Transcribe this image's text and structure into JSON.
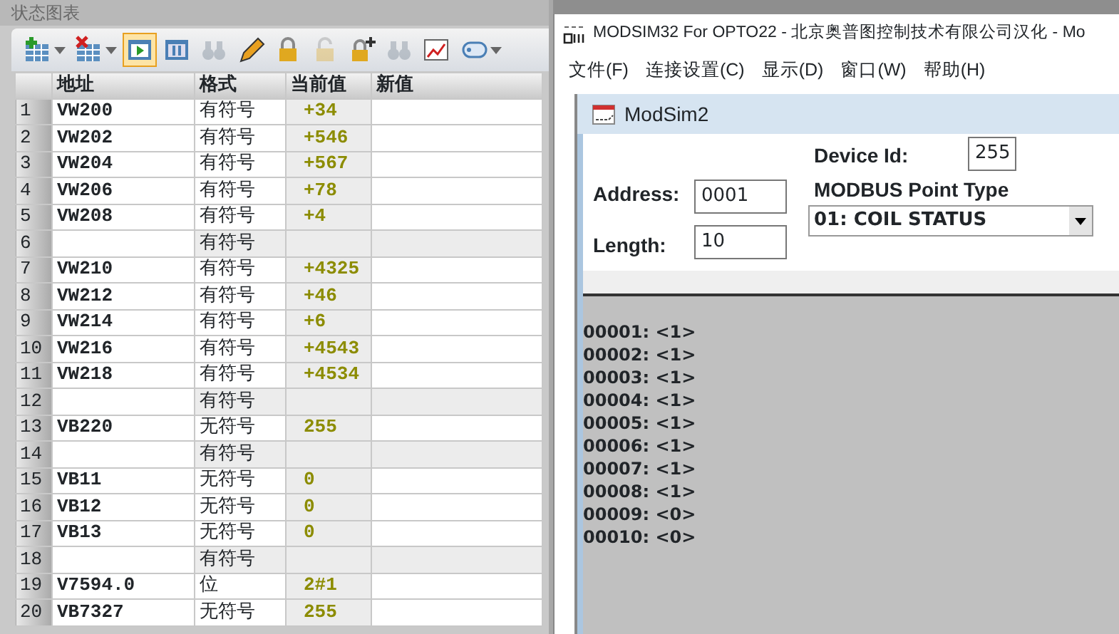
{
  "status_chart": {
    "title": "状态图表",
    "toolbar": [
      {
        "kind": "add-row",
        "caret": true,
        "selected": false,
        "disabled": false
      },
      {
        "kind": "delete-row",
        "caret": true,
        "selected": false,
        "disabled": false
      },
      {
        "kind": "play",
        "caret": false,
        "selected": true,
        "disabled": false
      },
      {
        "kind": "pause",
        "caret": false,
        "selected": false,
        "disabled": false
      },
      {
        "kind": "binoculars",
        "caret": false,
        "selected": false,
        "disabled": true
      },
      {
        "kind": "pencil",
        "caret": false,
        "selected": false,
        "disabled": false
      },
      {
        "kind": "lock",
        "caret": false,
        "selected": false,
        "disabled": false
      },
      {
        "kind": "unlock",
        "caret": false,
        "selected": false,
        "disabled": true
      },
      {
        "kind": "lock-plus",
        "caret": false,
        "selected": false,
        "disabled": false
      },
      {
        "kind": "binoculars",
        "caret": false,
        "selected": false,
        "disabled": true
      },
      {
        "kind": "chart",
        "caret": false,
        "selected": false,
        "disabled": false
      },
      {
        "kind": "tag",
        "caret": true,
        "selected": false,
        "disabled": false
      }
    ],
    "columns": [
      "地址",
      "格式",
      "当前值",
      "新值"
    ],
    "rows": [
      {
        "index": "1",
        "address": "VW200",
        "format": "有符号",
        "value": "+34"
      },
      {
        "index": "2",
        "address": "VW202",
        "format": "有符号",
        "value": "+546"
      },
      {
        "index": "3",
        "address": "VW204",
        "format": "有符号",
        "value": "+567"
      },
      {
        "index": "4",
        "address": "VW206",
        "format": "有符号",
        "value": "+78"
      },
      {
        "index": "5",
        "address": "VW208",
        "format": "有符号",
        "value": "+4"
      },
      {
        "index": "6",
        "format": "有符号"
      },
      {
        "index": "7",
        "address": "VW210",
        "format": "有符号",
        "value": "+4325"
      },
      {
        "index": "8",
        "address": "VW212",
        "format": "有符号",
        "value": "+46"
      },
      {
        "index": "9",
        "address": "VW214",
        "format": "有符号",
        "value": "+6"
      },
      {
        "index": "10",
        "address": "VW216",
        "format": "有符号",
        "value": "+4543"
      },
      {
        "index": "11",
        "address": "VW218",
        "format": "有符号",
        "value": "+4534"
      },
      {
        "index": "12",
        "format": "有符号"
      },
      {
        "index": "13",
        "address": "VB220",
        "format": "无符号",
        "value": "255"
      },
      {
        "index": "14",
        "format": "有符号"
      },
      {
        "index": "15",
        "address": "VB11",
        "format": "无符号",
        "value": "0"
      },
      {
        "index": "16",
        "address": "VB12",
        "format": "无符号",
        "value": "0"
      },
      {
        "index": "17",
        "address": "VB13",
        "format": "无符号",
        "value": "0"
      },
      {
        "index": "18",
        "format": "有符号"
      },
      {
        "index": "19",
        "address": "V7594.0",
        "format": "位",
        "value": "2#1"
      },
      {
        "index": "20",
        "address": "VB7327",
        "format": "无符号",
        "value": "255"
      }
    ]
  },
  "modsim_window": {
    "title": "MODSIM32 For OPTO22 - 北京奥普图控制技术有限公司汉化 - Mo",
    "menu": [
      "文件(F)",
      "连接设置(C)",
      "显示(D)",
      "窗口(W)",
      "帮助(H)"
    ],
    "child": {
      "title": "ModSim2",
      "device_id_label": "Device Id:",
      "device_id": "255",
      "address_label": "Address:",
      "address": "0001",
      "point_type_label": "MODBUS Point Type",
      "point_type": "01: COIL STATUS",
      "length_label": "Length:",
      "length": "10",
      "registers": [
        "00001: <1>",
        "00002: <1>",
        "00003: <1>",
        "00004: <1>",
        "00005: <1>",
        "00006: <1>",
        "00007: <1>",
        "00008: <1>",
        "00009: <0>",
        "00010: <0>"
      ]
    }
  }
}
